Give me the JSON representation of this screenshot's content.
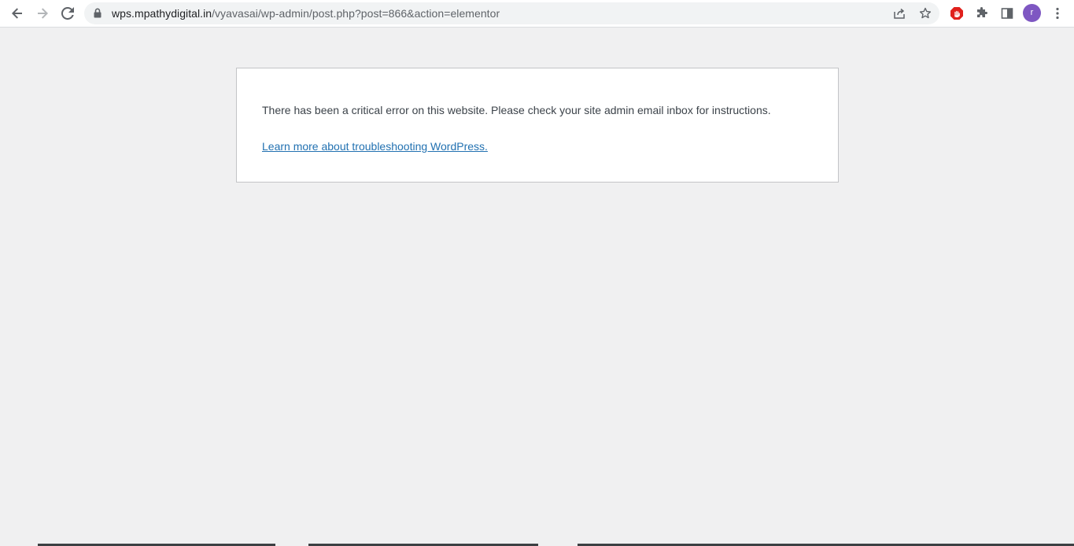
{
  "browser": {
    "url_host": "wps.mpathydigital.in",
    "url_path": "/vyavasai/wp-admin/post.php?post=866&action=elementor",
    "profile_initial": "r",
    "accent_color": "#7e57c2",
    "icons": [
      "back-arrow-icon",
      "forward-arrow-icon",
      "reload-icon",
      "lock-icon",
      "share-icon",
      "bookmark-star-icon",
      "adblock-icon",
      "extensions-puzzle-icon",
      "side-panel-icon",
      "kebab-menu-icon"
    ]
  },
  "page": {
    "error_message": "There has been a critical error on this website. Please check your site admin email inbox for instructions.",
    "help_link": "Learn more about troubleshooting WordPress.",
    "link_color": "#2271b1",
    "background_color": "#f0f0f1"
  }
}
